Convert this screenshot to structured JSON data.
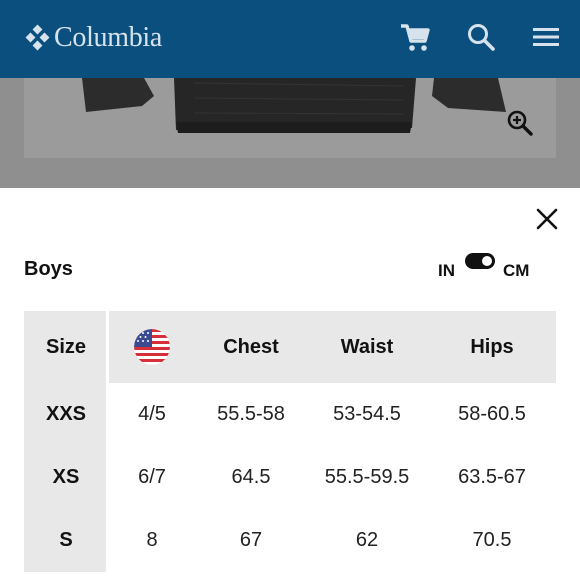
{
  "header": {
    "brand": "Columbia",
    "background_color": "#0b4f7e",
    "icons": [
      "cart-icon",
      "search-icon",
      "menu-icon"
    ]
  },
  "product": {
    "zoom_icon": "zoom-in-icon"
  },
  "size_chart": {
    "title": "Boys",
    "unit_left": "IN",
    "unit_right": "CM",
    "unit_toggle_selected": "CM",
    "close_icon": "close-icon",
    "columns": [
      "Size",
      "",
      "Chest",
      "Waist",
      "Hips"
    ],
    "flag_icon": "us-flag-icon",
    "rows": [
      {
        "size": "XXS",
        "us": "4/5",
        "chest": "55.5-58",
        "waist": "53-54.5",
        "hips": "58-60.5"
      },
      {
        "size": "XS",
        "us": "6/7",
        "chest": "64.5",
        "waist": "55.5-59.5",
        "hips": "63.5-67"
      },
      {
        "size": "S",
        "us": "8",
        "chest": "67",
        "waist": "62",
        "hips": "70.5"
      }
    ]
  }
}
